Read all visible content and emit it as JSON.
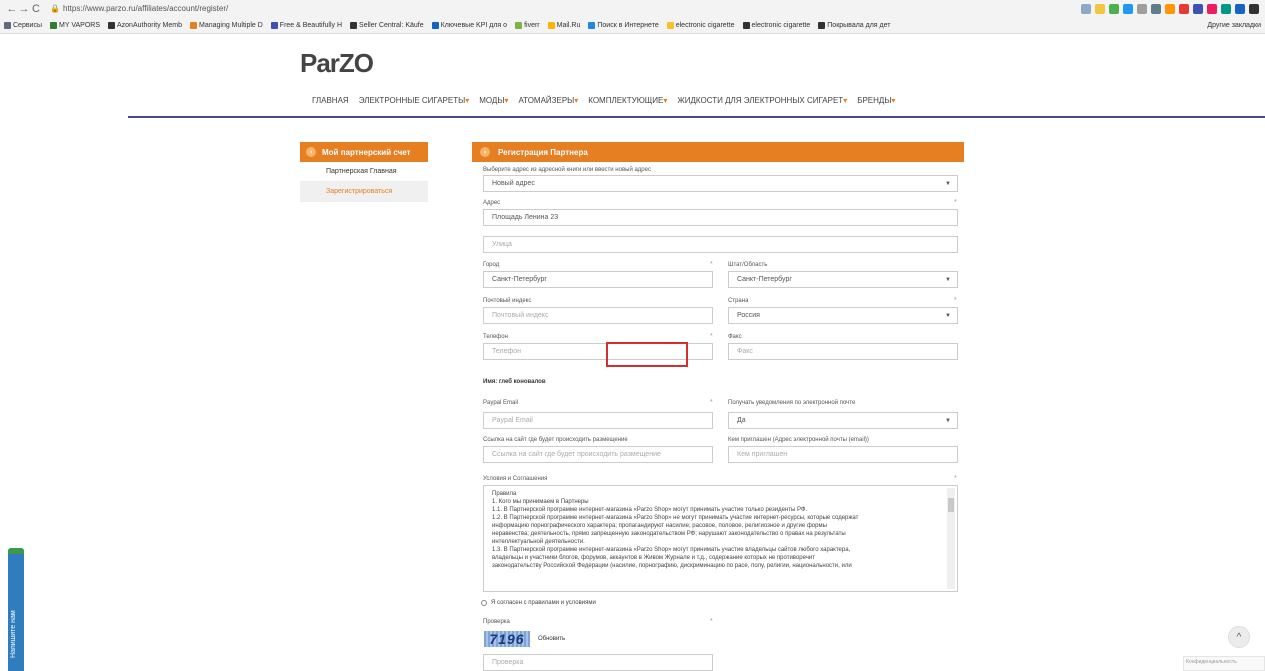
{
  "page_title": "partner registration page at Parzo",
  "browser": {
    "url": "https://www.parzo.ru/affiliates/account/register/",
    "bookmarks": [
      "Сервисы",
      "MY VAPORS",
      "AzonAuthority Memb",
      "Managing Multiple D",
      "Free & Beautifully H",
      "Seller Central: Käufe",
      "Ключевые KPI для о",
      "fiverr",
      "Mail.Ru",
      "Поиск в Интернете",
      "electronic cigarette",
      "electronic cigarette",
      "Покрывала для дет"
    ],
    "other_bookmarks": "Другие закладки"
  },
  "site": {
    "logo": "ParZO",
    "nav": [
      "ГЛАВНАЯ",
      "ЭЛЕКТРОННЫЕ СИГАРЕТЫ",
      "МОДЫ",
      "АТОМАЙЗЕРЫ",
      "КОМПЛЕКТУЮЩИЕ",
      "ЖИДКОСТИ ДЛЯ ЭЛЕКТРОННЫХ СИГАРЕТ",
      "БРЕНДЫ"
    ]
  },
  "sidebar": {
    "title": "Мой партнерский счет",
    "items": [
      {
        "label": "Партнерская Главная"
      },
      {
        "label": "Зарегистрироваться"
      }
    ]
  },
  "form": {
    "title": "Регистрация Партнера",
    "address_book_label": "Выберите адрес из адресной книги или ввести новый адрес",
    "address_book_value": "Новый адрес",
    "address_label": "Адрес",
    "address_value": "Площадь Ленина 23",
    "street_placeholder": "Улица",
    "city_label": "Город",
    "city_value": "Санкт-Петербург",
    "state_label": "Штат/Область",
    "state_value": "Санкт-Петербург",
    "zip_label": "Почтовый индекс",
    "zip_placeholder": "Почтовый индекс",
    "country_label": "Страна",
    "country_value": "Россия",
    "phone_label": "Телефон",
    "phone_placeholder": "Телефон",
    "fax_label": "Факс",
    "fax_placeholder": "Факс",
    "name_note": "Имя: глеб коновалов",
    "paypal_label": "Paypal Email",
    "paypal_placeholder": "Paypal Email",
    "notify_label": "Получать уведомления по электронной почте",
    "notify_value": "Да",
    "site_label": "Ссылка на сайт где будет происходить размещение",
    "site_placeholder": "Ссылка на сайт где будет происходить размещение",
    "referrer_label": "Кем приглашен (Адрес электронной почты (email))",
    "referrer_placeholder": "Кем приглашен",
    "terms_label": "Условия и Соглашения",
    "terms_lines": [
      "Правила",
      "1. Кого мы принимаем в Партнеры",
      "1.1. В Партнерской программе интернет-магазина «Parzo Shop» могут принимать участие только резиденты РФ.",
      "1.2. В Партнерской программе интернет-магазина «Parzo Shop» не могут принимать участие интернет-ресурсы, которые содержат",
      "информацию порнографического характера; пропагандируют насилие; расовое, половое, религиозное и другие формы",
      "неравенства; деятельность, прямо запрещенную законодательством РФ; нарушают законодательство о правах на результаты",
      "интеллектуальной деятельности.",
      "1.3. В Партнерской программе интернет-магазина «Parzo Shop» могут принимать участие владельцы сайтов любого характера,",
      "владельцы и участники блогов, форумов, аккаунтов в Живом Журнале и т.д., содержание которых не противоречит",
      "законодательству Российской Федерации (насилие, порнографию, дискриминацию по расе, полу, религии, национальности, или"
    ],
    "agree_label": "Я согласен с правилами и условиями",
    "captcha_label": "Проверка",
    "captcha_code": "7196",
    "refresh_label": "Обновить",
    "captcha_placeholder": "Проверка"
  },
  "feedback_tab": "Напишите нам",
  "recaptcha_text": "Конфиденциальность"
}
